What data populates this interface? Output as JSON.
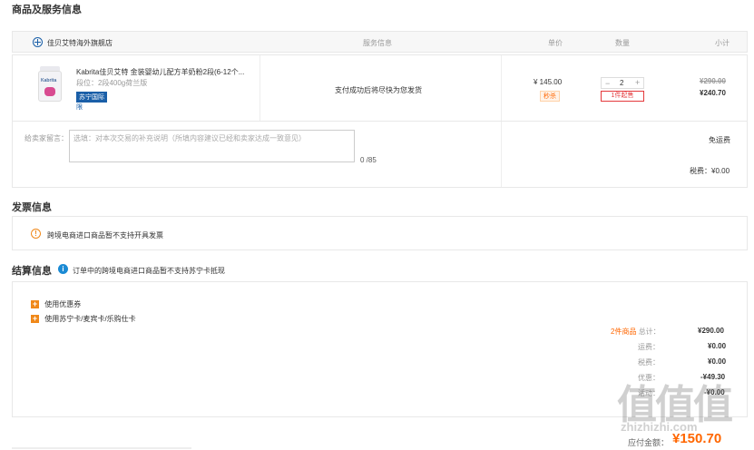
{
  "product_section": {
    "title": "商品及服务信息",
    "store_name": "佳贝艾特海外旗舰店",
    "col_service": "服务信息",
    "col_price": "单价",
    "col_qty": "数量",
    "col_subtotal": "小计"
  },
  "item": {
    "name": "Kabrita佳贝艾特 金装婴幼儿配方羊奶粉2段(6-12个...",
    "spec": "段位：2段400g荷兰版",
    "badge": "苏宁国际",
    "sub_tag": "限",
    "service": "支付成功后将尽快为您发货",
    "price": "¥ 145.00",
    "price_tag": "秒杀",
    "qty": "2",
    "qty_minus": "−",
    "qty_plus": "+",
    "qty_note": "1件起售",
    "original_subtotal": "¥290.00",
    "subtotal": "¥240.70",
    "package_label": "Kabrita"
  },
  "message": {
    "label": "给卖家留言：",
    "placeholder": "选填：对本次交易的补充说明（所填内容建议已经和卖家达成一致意见）",
    "counter": "0 /85",
    "shipping": "免运费",
    "tax": "税费：¥0.00"
  },
  "invoice": {
    "title": "发票信息",
    "notice": "跨境电商进口商品暂不支持开具发票"
  },
  "settlement": {
    "title": "结算信息",
    "notice": "订单中的跨境电商进口商品暂不支持苏宁卡抵现",
    "option_coupon": "使用优惠券",
    "option_card": "使用苏宁卡/麦宾卡/乐购仕卡",
    "count_prefix": "2件商品",
    "total_label": "总计：",
    "total_value": "¥290.00",
    "freight_label": "运费：",
    "freight_value": "¥0.00",
    "tax_label": "税费：",
    "tax_value": "¥0.00",
    "discount_label": "优惠：",
    "discount_value": "-¥49.30",
    "extra_label": "活动：",
    "extra_value": "-¥0.00",
    "payable_label": "应付金额：",
    "payable_value": "¥150.70"
  },
  "watermark": {
    "big": "值值值",
    "small": "zhizhizhi.com"
  },
  "colors": {
    "accent_red": "#e4393c",
    "orange": "#f60",
    "brand_blue": "#1a5fa8"
  }
}
